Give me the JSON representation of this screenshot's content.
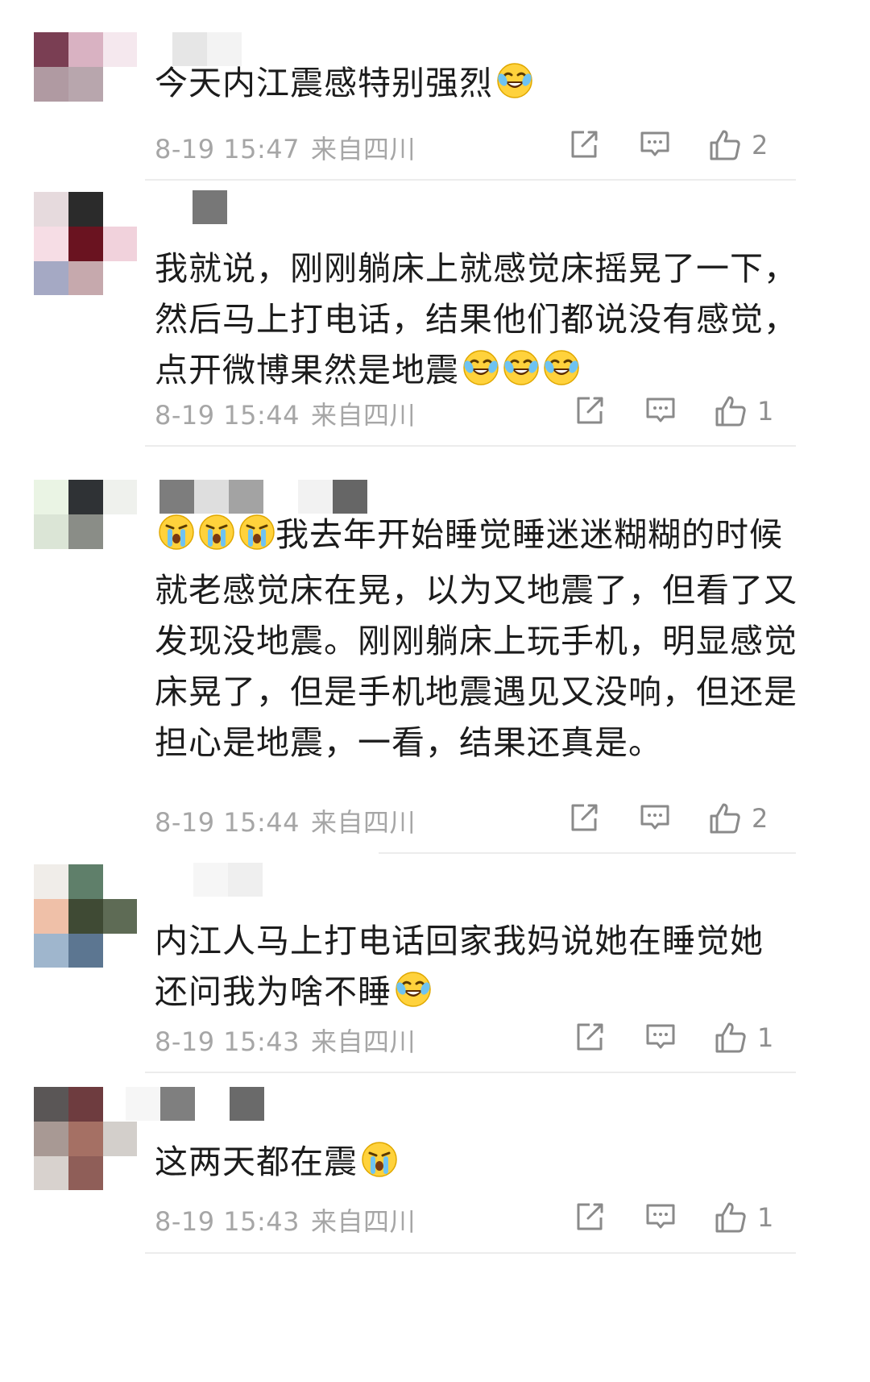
{
  "comments": [
    {
      "text": "今天内江震感特别强烈",
      "emoji": [
        "laugh-cry-emoji"
      ],
      "time": "8-19 15:47",
      "source": "来自四川",
      "likes": "2",
      "avatar_colors": [
        "#7a3e53",
        "#d9b2c2",
        "#f5e8ee",
        "#b09aa2",
        "#b8a6ad",
        "#ffffff",
        "#ffffff",
        "#ffffff",
        "#ffffff"
      ],
      "name_colors": [
        "#e6e6e6",
        "#f3f3f3"
      ]
    },
    {
      "text": "我就说，刚刚躺床上就感觉床摇晃了一下，然后马上打电话，结果他们都说没有感觉，点开微博果然是地震",
      "emoji": [
        "laugh-cry-emoji",
        "laugh-cry-emoji",
        "laugh-cry-emoji"
      ],
      "time": "8-19 15:44",
      "source": "来自四川",
      "likes": "1",
      "avatar_colors": [
        "#e6dadd",
        "#2b2b2b",
        "#ffffff",
        "#f6dde5",
        "#6a1320",
        "#f1d2dc",
        "#a5a9c4",
        "#c6a9ad",
        "#ffffff"
      ],
      "name_colors": [
        "#ffffff",
        "#777777"
      ]
    },
    {
      "text": "我去年开始睡觉睡迷迷糊糊的时候就老感觉床在晃，以为又地震了，但看了又发现没地震。刚刚躺床上玩手机，明显感觉床晃了，但是手机地震遇见又没响，但还是担心是地震，一看，结果还真是。",
      "emoji_lead": [
        "crying-emoji",
        "crying-emoji",
        "crying-emoji"
      ],
      "time": "8-19 15:44",
      "source": "来自四川",
      "likes": "2",
      "avatar_colors": [
        "#eaf4e4",
        "#2f3235",
        "#eff1ed",
        "#dbe5d6",
        "#8a8d87",
        "#ffffff",
        "#ffffff",
        "#ffffff",
        "#ffffff"
      ],
      "name_colors": [
        "#7d7d7d",
        "#dedede",
        "#a3a3a3",
        "#ffffff",
        "#f2f2f2",
        "#666666"
      ]
    },
    {
      "text": "内江人马上打电话回家我妈说她在睡觉她还问我为啥不睡",
      "emoji": [
        "laugh-cry-emoji"
      ],
      "time": "8-19 15:43",
      "source": "来自四川",
      "likes": "1",
      "avatar_colors": [
        "#f0ede9",
        "#5f7f6a",
        "#ffffff",
        "#efc0a8",
        "#3f4a34",
        "#5e6b55",
        "#9fb6cd",
        "#5c7691",
        "#ffffff"
      ],
      "name_colors": [
        "#f6f6f6",
        "#efefef"
      ]
    },
    {
      "text": "这两天都在震",
      "emoji": [
        "crying-emoji"
      ],
      "time": "8-19 15:43",
      "source": "来自四川",
      "likes": "1",
      "avatar_colors": [
        "#5a5656",
        "#6e3c3f",
        "#ffffff",
        "#a89994",
        "#a57064",
        "#d3cfcb",
        "#d8d2ce",
        "#8f5e58",
        "#ffffff"
      ],
      "name_colors": [
        "#f6f6f6",
        "#7f7f7f",
        "#ffffff",
        "#6a6a6a"
      ]
    }
  ]
}
